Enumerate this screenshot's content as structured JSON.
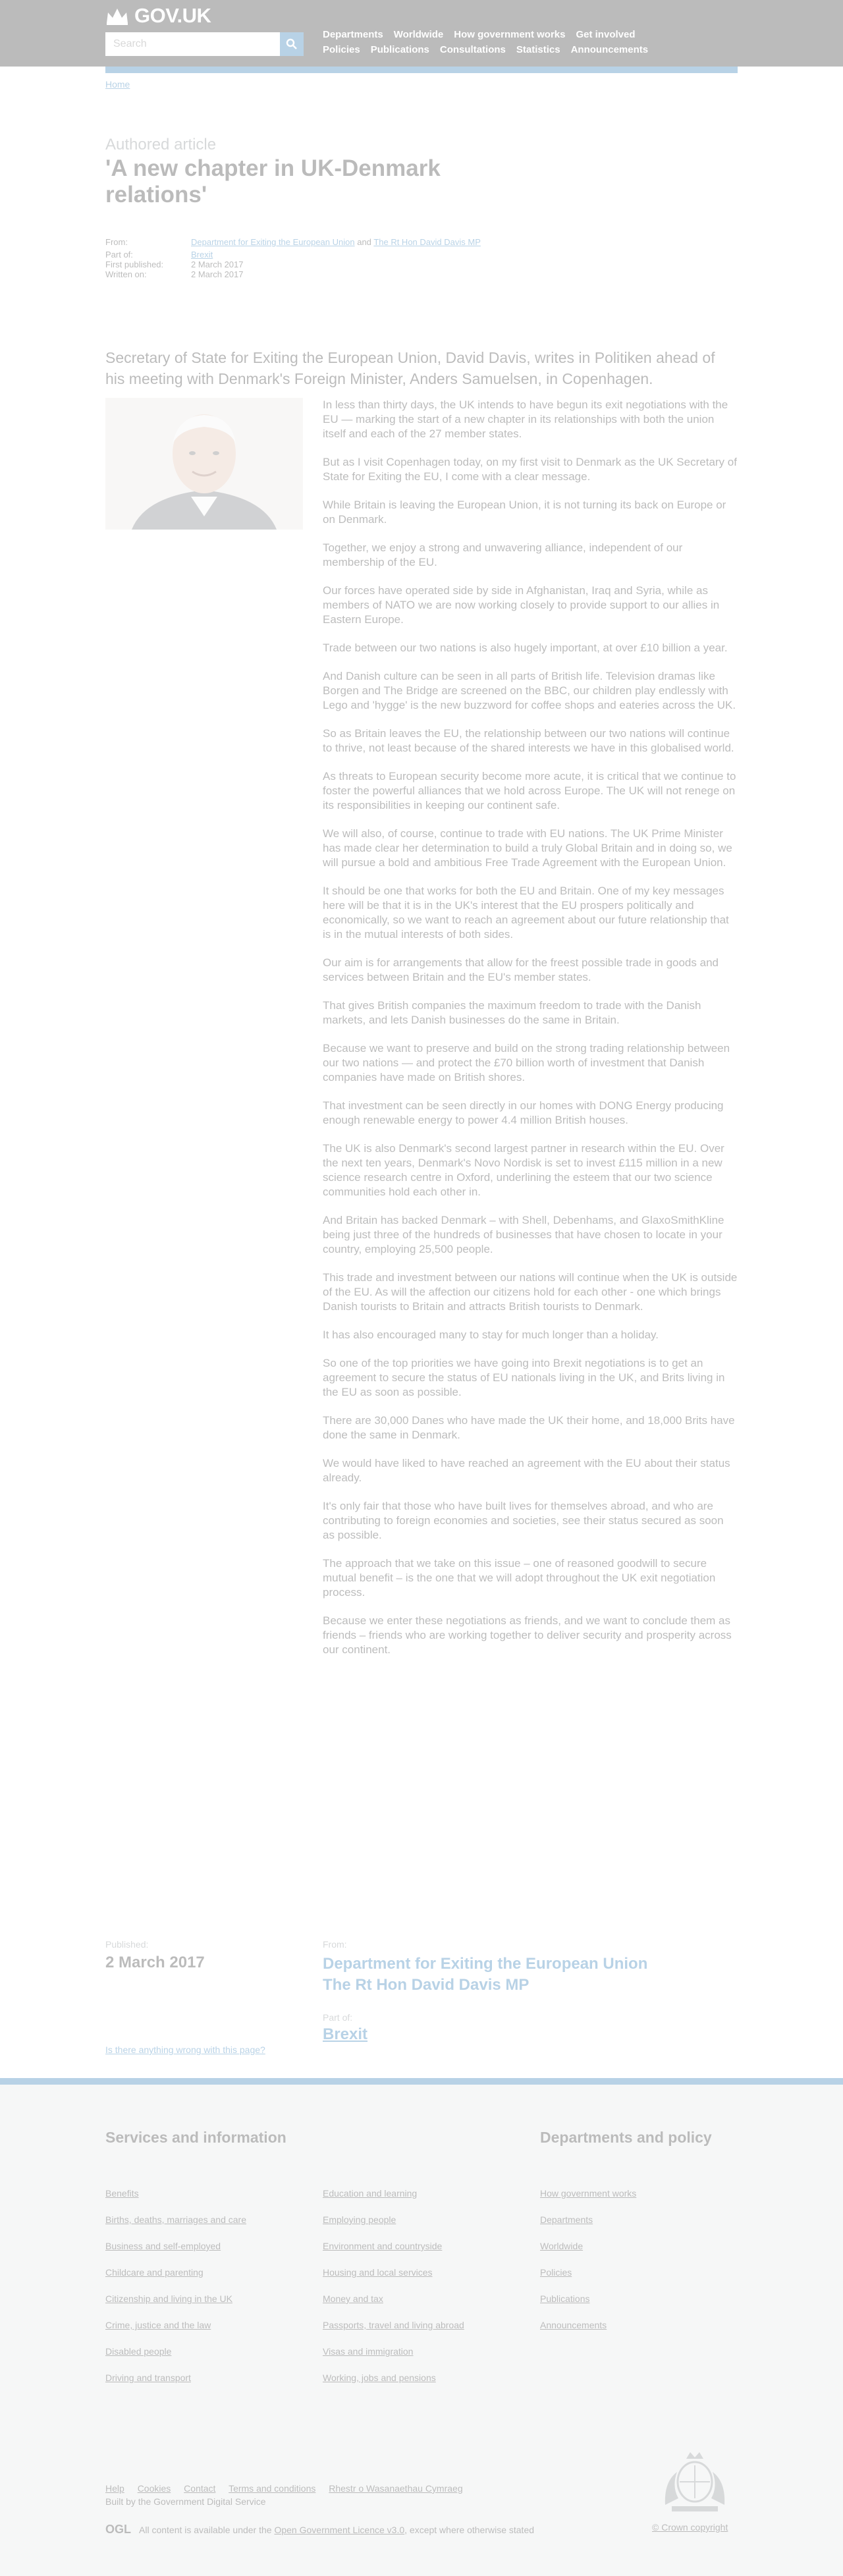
{
  "header": {
    "logo_text": "GOV.UK",
    "search_placeholder": "Search",
    "nav_row1": [
      "Departments",
      "Worldwide",
      "How government works",
      "Get involved"
    ],
    "nav_row2": [
      "Policies",
      "Publications",
      "Consultations",
      "Statistics",
      "Announcements"
    ]
  },
  "breadcrumb": "Home",
  "content_type": "Authored article",
  "title": "'A new chapter in UK-Denmark relations'",
  "metadata": {
    "from_label": "From:",
    "from_links": [
      "Department for Exiting the European Union",
      "The Rt Hon David Davis MP"
    ],
    "from_joiner": "and",
    "part_of_label": "Part of:",
    "part_of": "Brexit",
    "first_published_label": "First published:",
    "first_published": "2 March 2017",
    "written_on_label": "Written on:",
    "written_on": "2 March 2017"
  },
  "summary": "Secretary of State for Exiting the European Union, David Davis, writes in Politiken ahead of his meeting with Denmark's Foreign Minister, Anders Samuelsen, in Copenhagen.",
  "article": [
    "In less than thirty days, the UK intends to have begun its exit negotiations with the EU — marking the start of a new chapter in its relationships with both the union itself and each of the 27 member states.",
    "But as I visit Copenhagen today, on my first visit to Denmark as the UK Secretary of State for Exiting the EU, I come with a clear message.",
    "While Britain is leaving the European Union, it is not turning its back on Europe or on Denmark.",
    "Together, we enjoy a strong and unwavering alliance, independent of our membership of the EU.",
    "Our forces have operated side by side in Afghanistan, Iraq and Syria, while as members of NATO we are now working closely to provide support to our allies in Eastern Europe.",
    "Trade between our two nations is also hugely important, at over £10 billion a year.",
    "And Danish culture can be seen in all parts of British life. Television dramas like Borgen and The Bridge are screened on the BBC, our children play endlessly with Lego and 'hygge' is the new buzzword for coffee shops and eateries across the UK.",
    "So as Britain leaves the EU, the relationship between our two nations will continue to thrive, not least because of the shared interests we have in this globalised world.",
    "As threats to European security become more acute, it is critical that we continue to foster the powerful alliances that we hold across Europe. The UK will not renege on its responsibilities in keeping our continent safe.",
    "We will also, of course, continue to trade with EU nations. The UK Prime Minister has made clear her determination to build a truly Global Britain and in doing so, we will pursue a bold and ambitious Free Trade Agreement with the European Union.",
    "It should be one that works for both the EU and Britain. One of my key messages here will be that it is in the UK's interest that the EU prospers politically and economically, so we want to reach an agreement about our future relationship that is in the mutual interests of both sides.",
    "Our aim is for arrangements that allow for the freest possible trade in goods and services between Britain and the EU's member states.",
    "That gives British companies the maximum freedom to trade with the Danish markets, and lets Danish businesses do the same in Britain.",
    "Because we want to preserve and build on the strong trading relationship between our two nations — and protect the £70 billion worth of investment that Danish companies have made on British shores.",
    "That investment can be seen directly in our homes with DONG Energy producing enough renewable energy to power 4.4 million British houses.",
    "The UK is also Denmark's second largest partner in research within the EU. Over the next ten years, Denmark's Novo Nordisk is set to invest £115 million in a new science research centre in Oxford, underlining the esteem that our two science communities hold each other in.",
    "And Britain has backed Denmark – with Shell, Debenhams, and GlaxoSmithKline being just three of the hundreds of businesses that have chosen to locate in your country, employing 25,500 people.",
    "This trade and investment between our nations will continue when the UK is outside of the EU. As will the affection our citizens hold for each other - one which brings Danish tourists to Britain and attracts British tourists to Denmark.",
    "It has also encouraged many to stay for much longer than a holiday.",
    "So one of the top priorities we have going into Brexit negotiations is to get an agreement to secure the status of EU nationals living in the UK, and Brits living in the EU as soon as possible.",
    "There are 30,000 Danes who have made the UK their home, and 18,000 Brits have done the same in Denmark.",
    "We would have liked to have reached an agreement with the EU about their status already.",
    "It's only fair that those who have built lives for themselves abroad, and who are contributing to foreign economies and societies, see their status secured as soon as possible.",
    "The approach that we take on this issue – one of reasoned goodwill to secure mutual benefit – is the one that we will adopt throughout the UK exit negotiation process.",
    "Because we enter these negotiations as friends, and we want to conclude them as friends – friends who are working together to deliver security and prosperity across our continent."
  ],
  "published": {
    "label": "Published:",
    "date": "2 March 2017"
  },
  "from": {
    "label": "From:",
    "links": [
      "Department for Exiting the European Union",
      "The Rt Hon David Davis MP"
    ]
  },
  "part_of": {
    "label": "Part of:",
    "link": "Brexit"
  },
  "report_link": "Is there anything wrong with this page?",
  "footer": {
    "services_title": "Services and information",
    "departments_title": "Departments and policy",
    "services_col1": [
      "Benefits",
      "Births, deaths, marriages and care",
      "Business and self-employed",
      "Childcare and parenting",
      "Citizenship and living in the UK",
      "Crime, justice and the law",
      "Disabled people",
      "Driving and transport"
    ],
    "services_col2": [
      "Education and learning",
      "Employing people",
      "Environment and countryside",
      "Housing and local services",
      "Money and tax",
      "Passports, travel and living abroad",
      "Visas and immigration",
      "Working, jobs and pensions"
    ],
    "departments_col": [
      "How government works",
      "Departments",
      "Worldwide",
      "Policies",
      "Publications",
      "Announcements"
    ],
    "meta_links": [
      "Help",
      "Cookies",
      "Contact",
      "Terms and conditions",
      "Rhestr o Wasanaethau Cymraeg"
    ],
    "built_by": "Built by the Government Digital Service",
    "ogl_mark": "OGL",
    "licence_prefix": "All content is available under the",
    "licence_link": "Open Government Licence v3.0",
    "licence_suffix": ", except where otherwise stated",
    "copyright": "© Crown copyright"
  }
}
